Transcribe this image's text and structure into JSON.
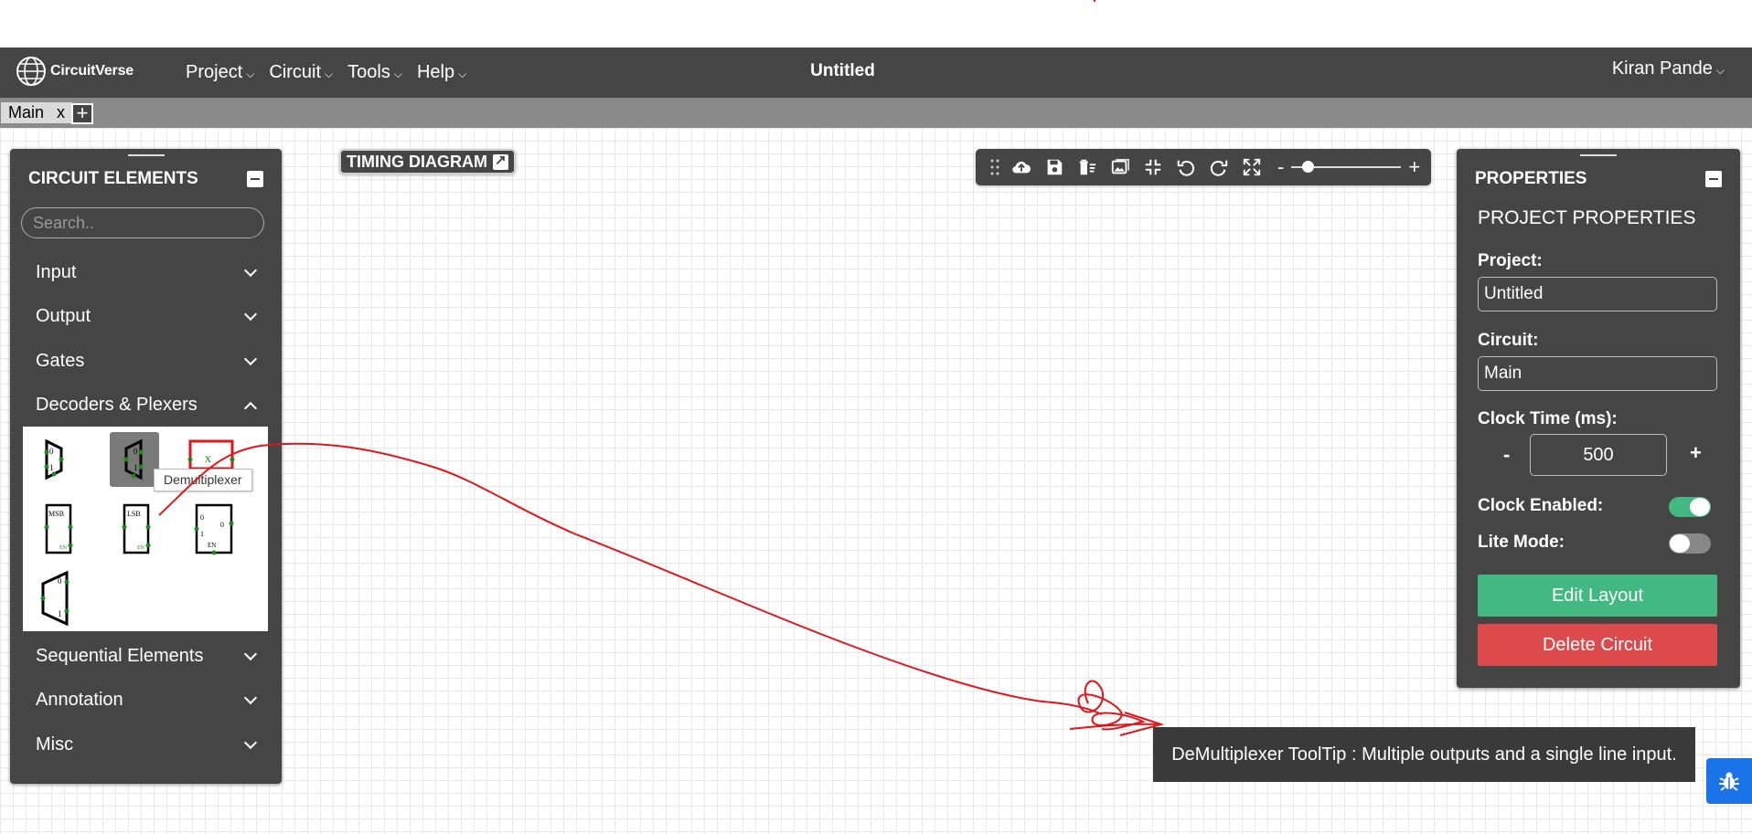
{
  "navbar": {
    "brand": "CircuitVerse",
    "menu": [
      {
        "label": "Project"
      },
      {
        "label": "Circuit"
      },
      {
        "label": "Tools"
      },
      {
        "label": "Help"
      }
    ],
    "title": "Untitled",
    "user": "Kiran Pande"
  },
  "tabs": {
    "active": "Main",
    "close": "x",
    "add": "+"
  },
  "circuit_elements": {
    "title": "CIRCUIT ELEMENTS",
    "search_placeholder": "Search..",
    "categories": [
      {
        "label": "Input"
      },
      {
        "label": "Output"
      },
      {
        "label": "Gates"
      },
      {
        "label": "Decoders & Plexers"
      },
      {
        "label": "Sequential Elements"
      },
      {
        "label": "Annotation"
      },
      {
        "label": "Misc"
      }
    ],
    "hover_tooltip": "Demultiplexer"
  },
  "timing_diagram": {
    "label": "TIMING DIAGRAM"
  },
  "toolbar": {
    "zoom_minus": "-",
    "zoom_plus": "+",
    "zoom_level": 0.15
  },
  "properties": {
    "title": "PROPERTIES",
    "heading": "PROJECT PROPERTIES",
    "project_label": "Project:",
    "project_value": "Untitled",
    "circuit_label": "Circuit:",
    "circuit_value": "Main",
    "clock_label": "Clock Time (ms):",
    "clock_minus": "-",
    "clock_plus": "+",
    "clock_value": "500",
    "clock_enabled_label": "Clock Enabled:",
    "clock_enabled": true,
    "lite_mode_label": "Lite Mode:",
    "lite_mode": false,
    "edit_layout": "Edit Layout",
    "delete_circuit": "Delete Circuit"
  },
  "tooltip": {
    "text": "DeMultiplexer ToolTip : Multiple outputs and a single line input."
  },
  "colors": {
    "navbar": "#454545",
    "tabbar": "#8a8a8a",
    "panel": "#454545",
    "toggle_on": "#42b983",
    "toggle_off": "#888888",
    "edit_button": "#42b983",
    "delete_button": "#dc4a4c",
    "annotation": "#e0161a",
    "bug_button": "#1a73e8"
  }
}
